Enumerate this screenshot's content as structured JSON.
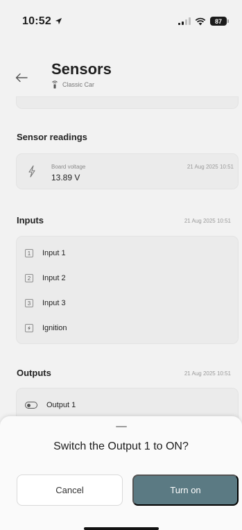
{
  "status_bar": {
    "time": "10:52",
    "battery": "87"
  },
  "header": {
    "title": "Sensors",
    "subtitle": "Classic Car"
  },
  "sensor_readings": {
    "title": "Sensor readings",
    "items": [
      {
        "label": "Board voltage",
        "value": "13.89 V",
        "timestamp": "21 Aug 2025 10:51",
        "icon": "bolt-icon"
      }
    ]
  },
  "inputs": {
    "title": "Inputs",
    "timestamp": "21 Aug 2025 10:51",
    "items": [
      {
        "badge": "1",
        "label": "Input 1"
      },
      {
        "badge": "2",
        "label": "Input 2"
      },
      {
        "badge": "3",
        "label": "Input 3"
      },
      {
        "badge": "ignition",
        "label": "Ignition"
      }
    ]
  },
  "outputs": {
    "title": "Outputs",
    "timestamp": "21 Aug 2025 10:51",
    "items": [
      {
        "label": "Output 1",
        "icon": "toggle-icon"
      }
    ]
  },
  "dialog": {
    "title": "Switch the Output 1 to ON?",
    "cancel_label": "Cancel",
    "confirm_label": "Turn on"
  },
  "colors": {
    "primary": "#5b7a83",
    "background": "#f2f2f2",
    "card": "#ebebeb"
  }
}
